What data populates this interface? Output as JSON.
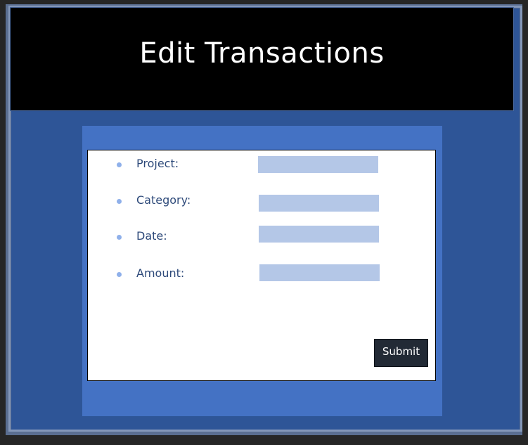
{
  "header": {
    "title": "Edit Transactions"
  },
  "form": {
    "fields": [
      {
        "label": "Project:",
        "value": ""
      },
      {
        "label": "Category:",
        "value": ""
      },
      {
        "label": "Date:",
        "value": ""
      },
      {
        "label": "Amount:",
        "value": ""
      }
    ],
    "submit_label": "Submit"
  },
  "colors": {
    "background": "#262626",
    "slide": "#2e5597",
    "header": "#000000",
    "panel": "#4472c4",
    "card": "#ffffff",
    "input": "#b4c7e7",
    "label": "#2e4a7a",
    "bullet": "#8fb0ea",
    "button": "#222a35"
  }
}
